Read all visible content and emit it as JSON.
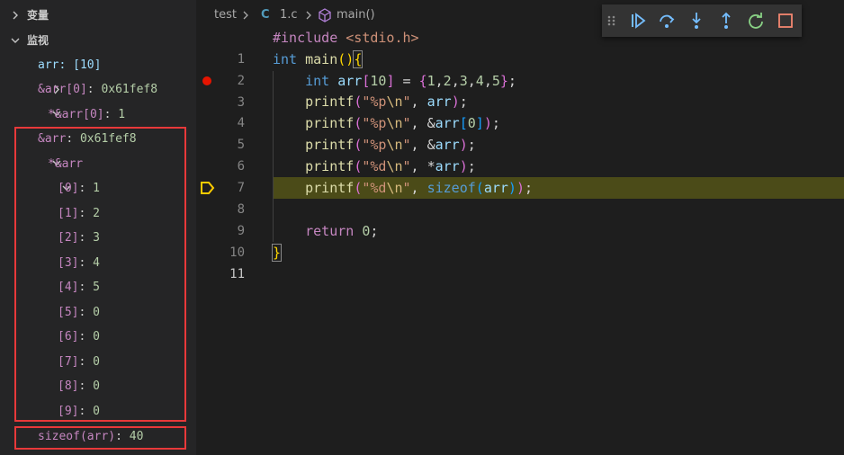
{
  "sidebar": {
    "variables_title": "变量",
    "watch_title": "监视",
    "watch_items": [
      {
        "label": "arr: [10]"
      },
      {
        "name": "&arr[0]",
        "sep": ": ",
        "value": "0x61fef8"
      },
      {
        "name": "*&arr[0]",
        "sep": ": ",
        "value": "1"
      },
      {
        "name": "&arr",
        "sep": ": ",
        "value": "0x61fef8"
      },
      {
        "name": "*&arr",
        "sep": "",
        "value": ""
      },
      {
        "name": "[0]",
        "sep": ": ",
        "value": "1"
      },
      {
        "name": "[1]",
        "sep": ": ",
        "value": "2"
      },
      {
        "name": "[2]",
        "sep": ": ",
        "value": "3"
      },
      {
        "name": "[3]",
        "sep": ": ",
        "value": "4"
      },
      {
        "name": "[4]",
        "sep": ": ",
        "value": "5"
      },
      {
        "name": "[5]",
        "sep": ": ",
        "value": "0"
      },
      {
        "name": "[6]",
        "sep": ": ",
        "value": "0"
      },
      {
        "name": "[7]",
        "sep": ": ",
        "value": "0"
      },
      {
        "name": "[8]",
        "sep": ": ",
        "value": "0"
      },
      {
        "name": "[9]",
        "sep": ": ",
        "value": "0"
      },
      {
        "name": "sizeof(arr)",
        "sep": ": ",
        "value": "40"
      }
    ]
  },
  "breadcrumb": {
    "folder": "test",
    "lang_badge": "C",
    "file": "1.c",
    "symbol": "main()"
  },
  "editor": {
    "line_numbers": [
      "1",
      "2",
      "3",
      "4",
      "5",
      "6",
      "7",
      "8",
      "9",
      "10",
      "11"
    ],
    "active_line": "11",
    "breakpoint_line": "3",
    "current_line": "8"
  },
  "debug_toolbar": {
    "buttons": [
      "continue-icon",
      "step-over-icon",
      "step-into-icon",
      "step-out-icon",
      "restart-icon",
      "stop-icon"
    ]
  },
  "colors": {
    "breakpoint": "#e51400",
    "current_line_highlight": "#4b4b18",
    "annotation_box": "#e8393a"
  }
}
